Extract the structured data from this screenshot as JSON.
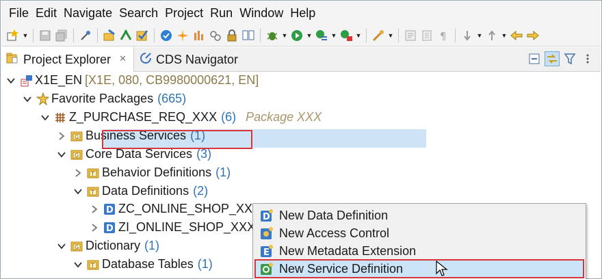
{
  "menu": [
    "File",
    "Edit",
    "Navigate",
    "Search",
    "Project",
    "Run",
    "Window",
    "Help"
  ],
  "toolbar_icons": [
    "new-wizard-icon",
    "save-icon",
    "save-all-icon",
    "abap-object-icon",
    "open-package-icon",
    "run-icon",
    "check-icon",
    "activate-icon",
    "activate-all-icon",
    "new-abap-class-icon",
    "transport-icon",
    "lock-icon",
    "compare-icon",
    "debug-icon",
    "run-green-icon",
    "coverage-icon",
    "profile-icon",
    "external-tools-icon",
    "toggle-mark-icon",
    "show-whitespace-icon",
    "next-annotation-icon",
    "prev-annotation-icon",
    "back-icon",
    "forward-icon"
  ],
  "tabs": {
    "project_explorer": "Project Explorer",
    "cds_navigator": "CDS Navigator"
  },
  "tree": {
    "system_name": "X1E_EN",
    "system_meta": "[X1E, 080, CB9980000621, EN]",
    "favorite_packages": "Favorite Packages",
    "favorite_packages_count": "(665)",
    "package_name": "Z_PURCHASE_REQ_XXX",
    "package_count": "(6)",
    "package_desc": "Package XXX",
    "business_services": "Business Services",
    "business_services_count": "(1)",
    "core_data_services": "Core Data Services",
    "core_data_services_count": "(3)",
    "behavior_definitions": "Behavior Definitions",
    "behavior_definitions_count": "(1)",
    "data_definitions": "Data Definitions",
    "data_definitions_count": "(2)",
    "zc_online_shop": "ZC_ONLINE_SHOP_XXX",
    "zi_online_shop": "ZI_ONLINE_SHOP_XXX",
    "dictionary": "Dictionary",
    "dictionary_count": "(1)",
    "database_tables": "Database Tables",
    "database_tables_count": "(1)"
  },
  "context_menu": {
    "new_data_definition": "New Data Definition",
    "new_access_control": "New Access Control",
    "new_metadata_extension": "New Metadata Extension",
    "new_service_definition": "New Service Definition"
  },
  "colors": {
    "count_blue": "#2e74b5",
    "highlight_red": "#d9353b",
    "selection": "#cfe3f6"
  }
}
